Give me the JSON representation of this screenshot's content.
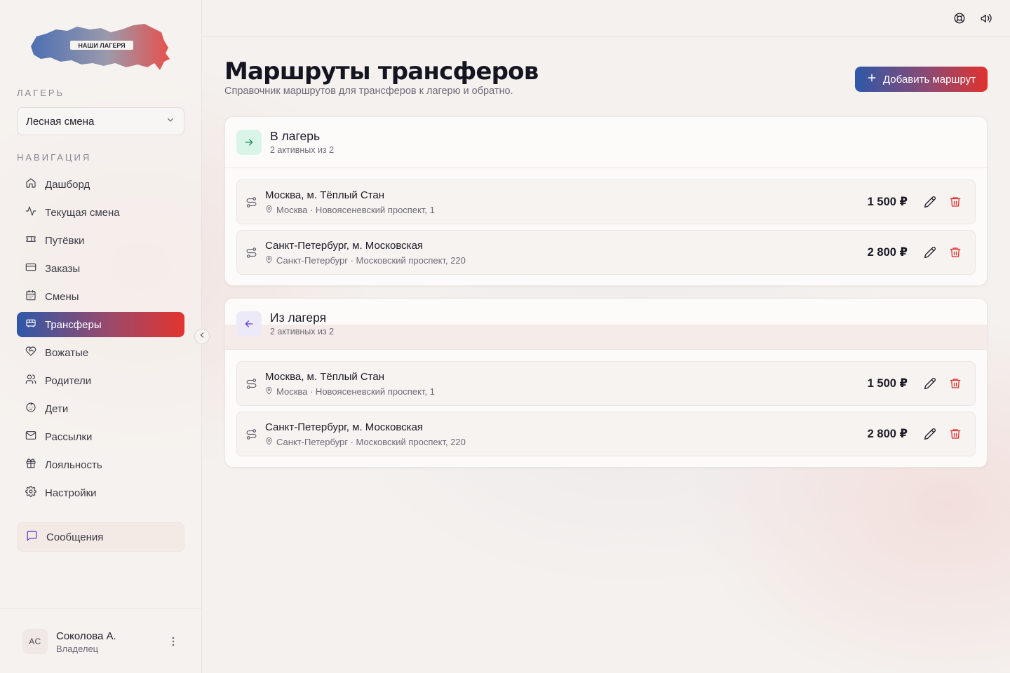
{
  "brand": {
    "logo_text": "НАШИ ЛАГЕРЯ"
  },
  "sidebar": {
    "camp_label": "ЛАГЕРЬ",
    "camp_selected": "Лесная смена",
    "nav_label": "НАВИГАЦИЯ",
    "items": [
      {
        "label": "Дашборд",
        "icon": "home-icon"
      },
      {
        "label": "Текущая смена",
        "icon": "activity-icon"
      },
      {
        "label": "Путёвки",
        "icon": "ticket-icon"
      },
      {
        "label": "Заказы",
        "icon": "credit-card-icon"
      },
      {
        "label": "Смены",
        "icon": "calendar-icon"
      },
      {
        "label": "Трансферы",
        "icon": "bus-icon",
        "active": true
      },
      {
        "label": "Вожатые",
        "icon": "heart-handshake-icon"
      },
      {
        "label": "Родители",
        "icon": "users-icon"
      },
      {
        "label": "Дети",
        "icon": "baby-icon"
      },
      {
        "label": "Рассылки",
        "icon": "mail-icon"
      },
      {
        "label": "Лояльность",
        "icon": "gift-icon"
      },
      {
        "label": "Настройки",
        "icon": "settings-icon"
      }
    ],
    "messages_label": "Сообщения",
    "user": {
      "initials": "АС",
      "name": "Соколова А.",
      "role": "Владелец"
    }
  },
  "topbar": {
    "icons": [
      "help-circle-icon",
      "megaphone-icon"
    ]
  },
  "page": {
    "title": "Маршруты трансферов",
    "subtitle": "Справочник маршрутов для трансферов к лагерю и обратно.",
    "add_button": "Добавить маршрут"
  },
  "sections": [
    {
      "title": "В лагерь",
      "count": "2 активных из 2",
      "icon": "arrow-right-icon",
      "routes": [
        {
          "name": "Москва, м. Тёплый Стан",
          "address": "Москва · Новоясеневский проспект, 1",
          "price": "1 500 ₽"
        },
        {
          "name": "Санкт-Петербург, м. Московская",
          "address": "Санкт-Петербург · Московский проспект, 220",
          "price": "2 800 ₽"
        }
      ]
    },
    {
      "title": "Из лагеря",
      "count": "2 активных из 2",
      "icon": "arrow-left-icon",
      "routes": [
        {
          "name": "Москва, м. Тёплый Стан",
          "address": "Москва · Новоясеневский проспект, 1",
          "price": "1 500 ₽"
        },
        {
          "name": "Санкт-Петербург, м. Московская",
          "address": "Санкт-Петербург · Московский проспект, 220",
          "price": "2 800 ₽"
        }
      ]
    }
  ],
  "colors": {
    "accent_start": "#2f58a8",
    "accent_end": "#e3342f",
    "delete": "#e02c2c",
    "in_badge": "#d9f5e7",
    "out_badge": "#ece9f8"
  }
}
